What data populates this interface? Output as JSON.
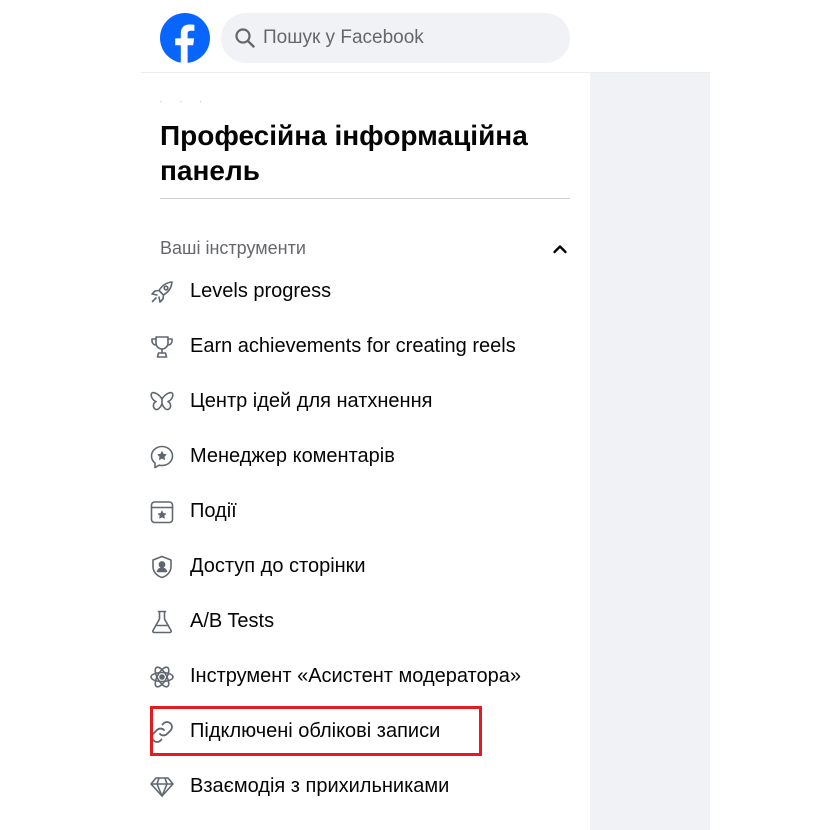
{
  "header": {
    "logo_icon": "facebook-logo-icon",
    "search": {
      "placeholder": "Пошук у Facebook",
      "value": "",
      "icon": "search-icon"
    }
  },
  "sidebar": {
    "title": "Професійна інформаційна панель",
    "section": {
      "title": "Ваші інструменти",
      "state": "expanded",
      "items": [
        {
          "label": "Levels progress",
          "icon": "rocket-icon"
        },
        {
          "label": "Earn achievements for creating reels",
          "icon": "trophy-icon"
        },
        {
          "label": "Центр ідей для натхнення",
          "icon": "butterfly-icon"
        },
        {
          "label": "Менеджер коментарів",
          "icon": "comment-star-icon"
        },
        {
          "label": "Події",
          "icon": "calendar-star-icon"
        },
        {
          "label": "Доступ до сторінки",
          "icon": "shield-user-icon"
        },
        {
          "label": "A/B Tests",
          "icon": "flask-icon"
        },
        {
          "label": "Інструмент «Асистент модератора»",
          "icon": "atom-icon"
        },
        {
          "label": "Підключені облікові записи",
          "icon": "link-icon",
          "highlighted": true
        },
        {
          "label": "Взаємодія з прихильниками",
          "icon": "diamond-icon"
        }
      ]
    }
  },
  "colors": {
    "brand": "#0866ff",
    "highlight": "#e41b23",
    "text_primary": "#050505",
    "text_secondary": "#65676b",
    "search_bg": "#f0f2f5"
  }
}
